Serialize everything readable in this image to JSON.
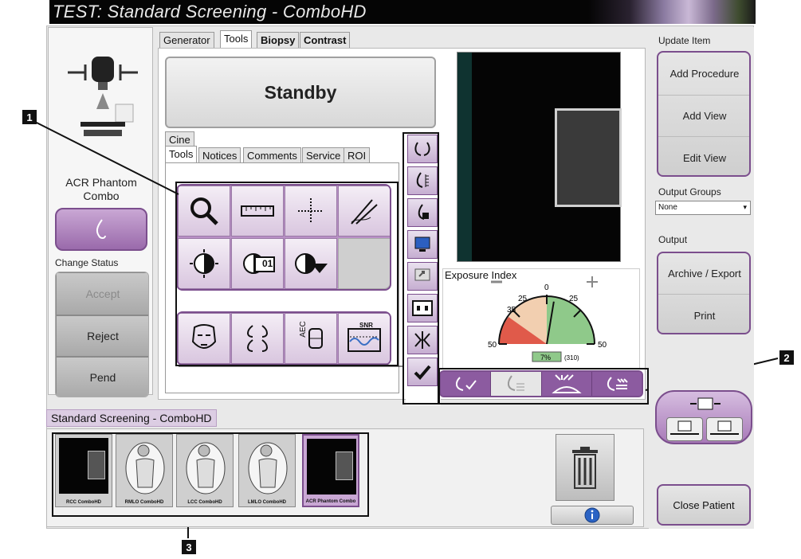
{
  "window": {
    "title": "TEST:  Standard Screening - ComboHD"
  },
  "left": {
    "procedure_label": "ACR Phantom Combo",
    "change_status": "Change Status",
    "accept": "Accept",
    "reject": "Reject",
    "pend": "Pend"
  },
  "tabs_top": [
    "Generator",
    "Tools",
    "Biopsy",
    "Contrast"
  ],
  "standby": "Standby",
  "cine_tab": "Cine",
  "tabs_tools": [
    "Tools",
    "Notices",
    "Comments",
    "Service",
    "ROI"
  ],
  "tools": {
    "row1": [
      "magnifier-icon",
      "ruler-icon",
      "crosshair-icon",
      "annotation-icon"
    ],
    "row2": [
      "contrast-icon",
      "contrast-preset-01-icon",
      "contrast-dropdown-icon"
    ],
    "row3": [
      "face-icon",
      "compare-icon",
      "aec-icon",
      "snr-icon"
    ],
    "preset_label": "01",
    "aec_label": "AEC",
    "snr_label": "SNR"
  },
  "vertical_tools": [
    "breast-select-icon",
    "breast-measure-icon",
    "breast-marker-icon",
    "monitor-icon",
    "send-monitor-icon",
    "dual-view-icon",
    "flip-icon",
    "accept-check-icon"
  ],
  "exposure": {
    "title": "Exposure Index",
    "ticks": [
      "0",
      "25",
      "25",
      "35",
      "50",
      "50"
    ],
    "percent": "7%",
    "value": "(310)",
    "level_fraction": 0.07
  },
  "bottom_tools": [
    "view-accept-icon",
    "view-list-icon",
    "compression-icon",
    "view-notes-icon"
  ],
  "study_label": "Standard Screening - ComboHD",
  "thumbnails": [
    {
      "label": "RCC ComboHD",
      "kind": "phantom"
    },
    {
      "label": "RMLO ComboHD",
      "kind": "figure"
    },
    {
      "label": "LCC ComboHD",
      "kind": "figure"
    },
    {
      "label": "LMLO ComboHD",
      "kind": "figure"
    },
    {
      "label": "ACR Phantom Combo",
      "kind": "phantom-active"
    }
  ],
  "right": {
    "update_item": "Update Item",
    "add_procedure": "Add Procedure",
    "add_view": "Add View",
    "edit_view": "Edit View",
    "output_groups": "Output Groups",
    "output_groups_value": "None",
    "output": "Output",
    "archive_export": "Archive / Export",
    "print": "Print",
    "close_patient": "Close Patient"
  },
  "callouts": [
    "1",
    "2",
    "3"
  ],
  "colors": {
    "accent": "#9a6aab",
    "accent_dark": "#7b4e8d",
    "gauge_green": "#8fc98a",
    "gauge_red": "#e05a4a"
  }
}
